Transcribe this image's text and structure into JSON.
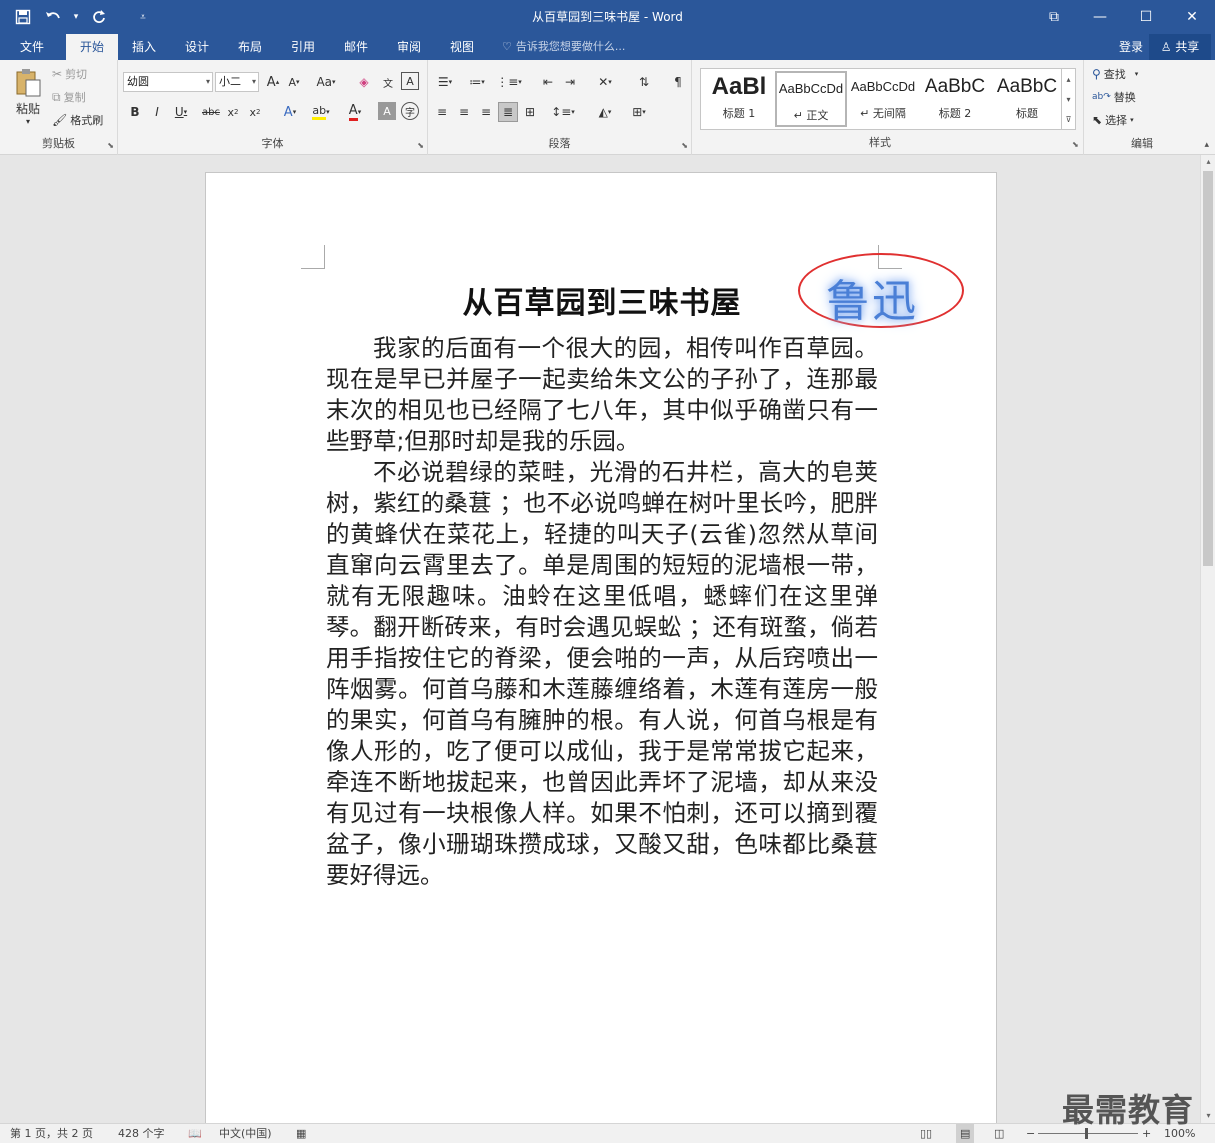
{
  "window": {
    "title": "从百草园到三味书屋 - Word",
    "qat": {
      "save_icon": "save-icon",
      "undo_icon": "undo-icon",
      "redo_icon": "redo-icon"
    },
    "controls": {
      "ribbon_display": "⧉",
      "minimize": "—",
      "maximize": "☐",
      "close": "✕"
    }
  },
  "tabs": [
    {
      "label": "文件",
      "active": false
    },
    {
      "label": "开始",
      "active": true
    },
    {
      "label": "插入",
      "active": false
    },
    {
      "label": "设计",
      "active": false
    },
    {
      "label": "布局",
      "active": false
    },
    {
      "label": "引用",
      "active": false
    },
    {
      "label": "邮件",
      "active": false
    },
    {
      "label": "审阅",
      "active": false
    },
    {
      "label": "视图",
      "active": false
    }
  ],
  "tell_me": "告诉我您想要做什么...",
  "sign_in": "登录",
  "share": "共享",
  "ribbon": {
    "clipboard": {
      "label": "剪贴板",
      "paste": "粘贴",
      "cut": "剪切",
      "copy": "复制",
      "format_painter": "格式刷"
    },
    "font": {
      "label": "字体",
      "font_name": "幼圆",
      "font_size": "小二"
    },
    "paragraph": {
      "label": "段落"
    },
    "styles": {
      "label": "样式",
      "items": [
        {
          "preview": "AaBl",
          "name": "标题 1"
        },
        {
          "preview": "AaBbCcDd",
          "name": "↵ 正文"
        },
        {
          "preview": "AaBbCcDd",
          "name": "↵ 无间隔"
        },
        {
          "preview": "AaBbC",
          "name": "标题 2"
        },
        {
          "preview": "AaBbC",
          "name": "标题"
        }
      ]
    },
    "editing": {
      "label": "编辑",
      "find": "查找",
      "replace": "替换",
      "select": "选择"
    }
  },
  "document": {
    "title": "从百草园到三味书屋",
    "author": "鲁迅",
    "paragraphs": [
      "我家的后面有一个很大的园，相传叫作百草园。现在是早已并屋子一起卖给朱文公的子孙了，连那最末次的相见也已经隔了七八年，其中似乎确凿只有一些野草;但那时却是我的乐园。",
      "不必说碧绿的菜畦，光滑的石井栏，高大的皂荚树，紫红的桑葚 ；也不必说鸣蝉在树叶里长吟，肥胖的黄蜂伏在菜花上，轻捷的叫天子(云雀)忽然从草间直窜向云霄里去了。单是周围的短短的泥墙根一带，就有无限趣味。油蛉在这里低唱，蟋蟀们在这里弹琴。翻开断砖来，有时会遇见蜈蚣 ；还有斑蝥，倘若用手指按住它的脊梁，便会啪的一声，从后窍喷出一阵烟雾。何首乌藤和木莲藤缠络着，木莲有莲房一般的果实，何首乌有臃肿的根。有人说，何首乌根是有像人形的，吃了便可以成仙，我于是常常拔它起来，牵连不断地拔起来，也曾因此弄坏了泥墙，却从来没有见过有一块根像人样。如果不怕刺，还可以摘到覆盆子，像小珊瑚珠攒成球，又酸又甜，色味都比桑葚要好得远。"
    ]
  },
  "status": {
    "page": "第 1 页，共 2 页",
    "words": "428 个字",
    "language": "中文(中国)",
    "zoom": "100%"
  },
  "watermark": "最需教育"
}
